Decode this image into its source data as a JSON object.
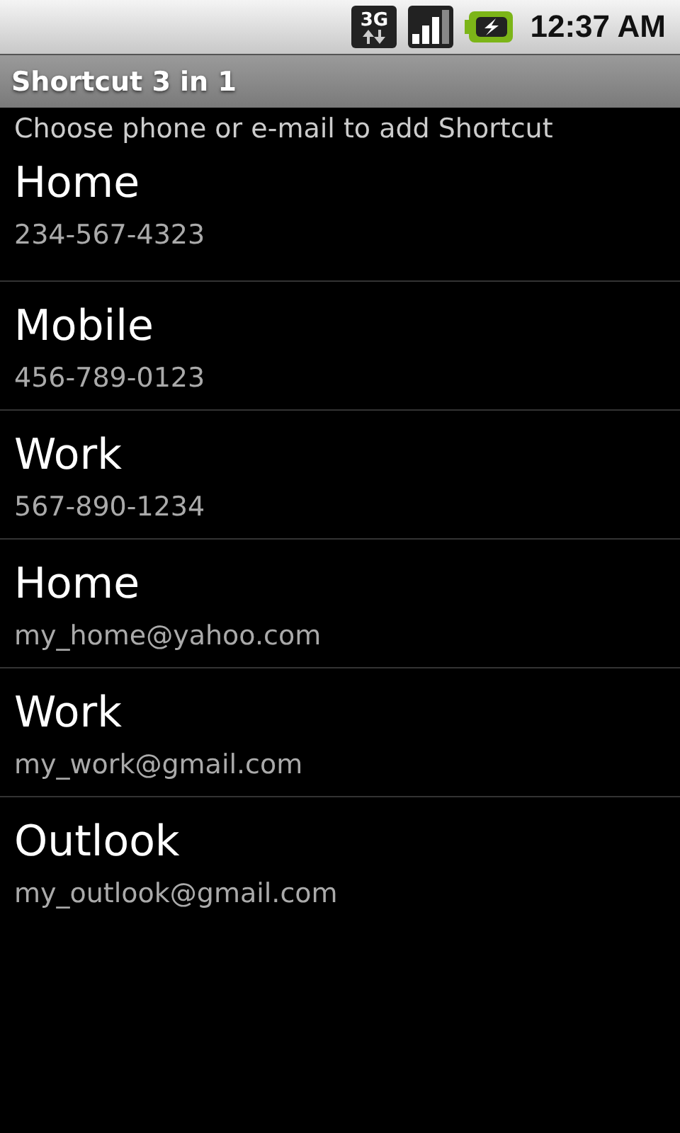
{
  "status_bar": {
    "network": "3G",
    "time": "12:37 AM"
  },
  "window": {
    "title": "Shortcut 3 in 1"
  },
  "prompt": "Choose phone or e-mail to add Shortcut",
  "contacts": [
    {
      "label": "Home",
      "value": "234-567-4323"
    },
    {
      "label": "Mobile",
      "value": "456-789-0123"
    },
    {
      "label": "Work",
      "value": "567-890-1234"
    },
    {
      "label": "Home",
      "value": "my_home@yahoo.com"
    },
    {
      "label": "Work",
      "value": "my_work@gmail.com"
    },
    {
      "label": "Outlook",
      "value": "my_outlook@gmail.com"
    }
  ]
}
